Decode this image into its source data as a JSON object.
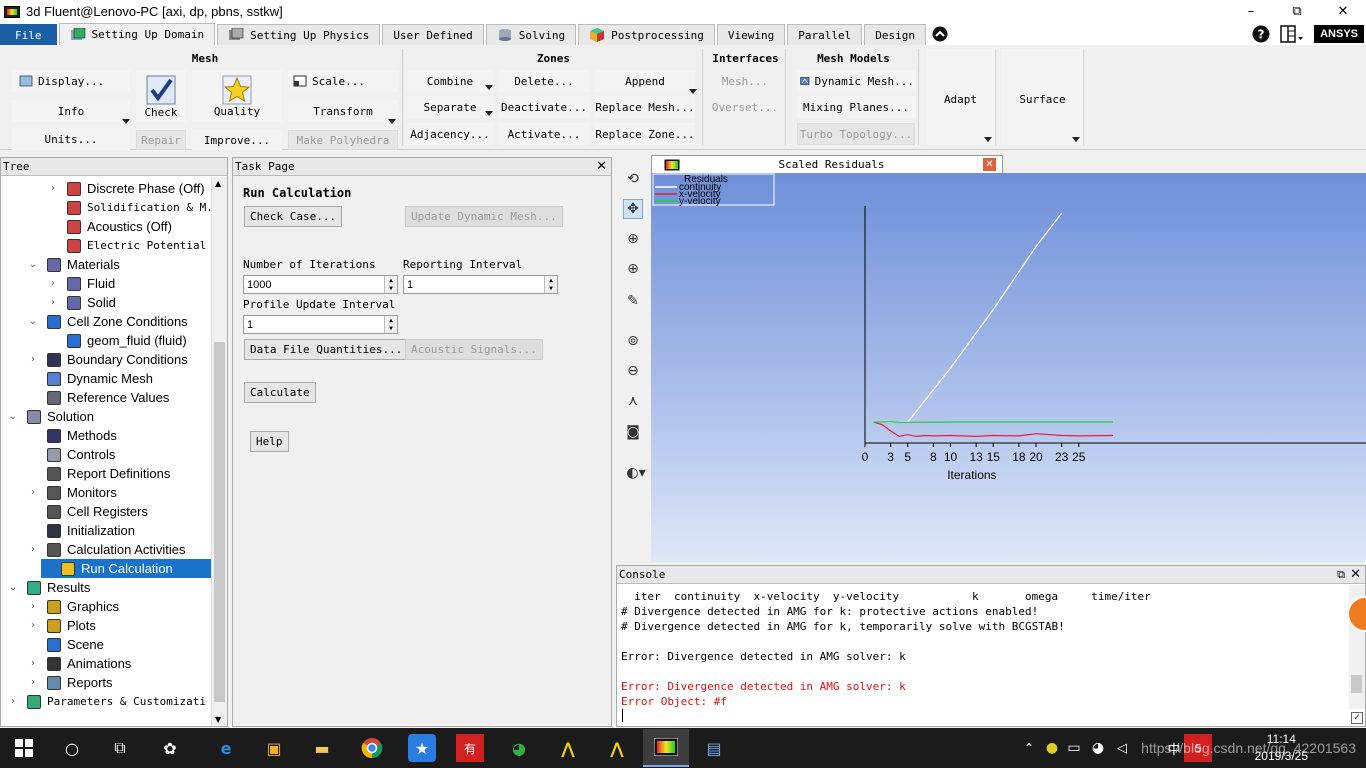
{
  "window": {
    "title": "3d Fluent@Lenovo-PC  [axi, dp, pbns, sstkw]",
    "controls": [
      "–",
      "⧉",
      "✕"
    ]
  },
  "tabs": [
    "File",
    "Setting Up Domain",
    "Setting Up Physics",
    "User Defined",
    "Solving",
    "Postprocessing",
    "Viewing",
    "Parallel",
    "Design"
  ],
  "tab_right": {
    "help": "?",
    "brand": "ANSYS"
  },
  "ribbon": {
    "mesh": {
      "title": "Mesh",
      "display": "Display...",
      "info": "Info",
      "units": "Units...",
      "check": "Check",
      "repair": "Repair",
      "quality": "Quality",
      "improve": "Improve...",
      "scale": "Scale...",
      "transform": "Transform",
      "make_polyhedra": "Make Polyhedra"
    },
    "zones": {
      "title": "Zones",
      "combine": "Combine",
      "separate": "Separate",
      "adjacency": "Adjacency...",
      "delete": "Delete...",
      "deactivate": "Deactivate...",
      "activate": "Activate...",
      "append": "Append",
      "replace_mesh": "Replace Mesh...",
      "replace_zone": "Replace Zone..."
    },
    "interfaces": {
      "title": "Interfaces",
      "mesh": "Mesh...",
      "overset": "Overset..."
    },
    "mesh_models": {
      "title": "Mesh Models",
      "dynamic_mesh": "Dynamic Mesh...",
      "mixing_planes": "Mixing Planes...",
      "turbo_topology": "Turbo Topology..."
    },
    "adapt": "Adapt",
    "surface": "Surface"
  },
  "tree": {
    "header": "Tree",
    "items": [
      {
        "label": "Discrete Phase (Off)"
      },
      {
        "label": "Solidification & M..."
      },
      {
        "label": "Acoustics (Off)"
      },
      {
        "label": "Electric Potential ("
      },
      {
        "label": "Materials"
      },
      {
        "label": "Fluid"
      },
      {
        "label": "Solid"
      },
      {
        "label": "Cell Zone Conditions"
      },
      {
        "label": "geom_fluid (fluid)"
      },
      {
        "label": "Boundary Conditions"
      },
      {
        "label": "Dynamic Mesh"
      },
      {
        "label": "Reference Values"
      },
      {
        "label": "Solution"
      },
      {
        "label": "Methods"
      },
      {
        "label": "Controls"
      },
      {
        "label": "Report Definitions"
      },
      {
        "label": "Monitors"
      },
      {
        "label": "Cell Registers"
      },
      {
        "label": "Initialization"
      },
      {
        "label": "Calculation Activities"
      },
      {
        "label": "Run Calculation"
      },
      {
        "label": "Results"
      },
      {
        "label": "Graphics"
      },
      {
        "label": "Plots"
      },
      {
        "label": "Scene"
      },
      {
        "label": "Animations"
      },
      {
        "label": "Reports"
      },
      {
        "label": "Parameters & Customizati"
      }
    ]
  },
  "task": {
    "header": "Task Page",
    "heading": "Run Calculation",
    "check_case": "Check Case...",
    "update_dynamic_mesh": "Update Dynamic Mesh...",
    "num_iter_label": "Number of Iterations",
    "num_iter_value": "1000",
    "report_interval_label": "Reporting Interval",
    "report_interval_value": "1",
    "profile_update_label": "Profile Update Interval",
    "profile_update_value": "1",
    "data_file_quantities": "Data File Quantities...",
    "acoustic_signals": "Acoustic Signals...",
    "calculate": "Calculate",
    "help": "Help"
  },
  "graphics": {
    "tab_title": "Scaled Residuals"
  },
  "chart_data": {
    "type": "line",
    "title": "",
    "legend_title": "Residuals",
    "xlabel": "Iterations",
    "ylabel": "",
    "x_ticks": [
      "0",
      "3",
      "5",
      "8",
      "10",
      "13",
      "15",
      "18",
      "20",
      "23",
      "25"
    ],
    "xlim": [
      0,
      29
    ],
    "legend_position": "top-left",
    "series": [
      {
        "name": "continuity",
        "color": "#ffffff",
        "x": [
          1,
          2,
          3,
          4,
          5,
          10,
          15,
          20,
          23
        ],
        "y": [
          1.0,
          1.0,
          1.0,
          1.0,
          1.0,
          7.0,
          13.5,
          20.5,
          24.2
        ]
      },
      {
        "name": "x-velocity",
        "color": "#e0203a",
        "x": [
          1,
          2,
          3,
          4,
          5,
          6,
          7,
          8,
          10,
          13,
          15,
          18,
          20,
          23,
          25,
          29
        ],
        "y": [
          1.0,
          0.7,
          0.0,
          -0.6,
          -0.4,
          -0.6,
          -0.5,
          -0.55,
          -0.5,
          -0.6,
          -0.5,
          -0.55,
          -0.3,
          -0.5,
          -0.55,
          -0.5
        ]
      },
      {
        "name": "y-velocity",
        "color": "#20d040",
        "x": [
          1,
          2,
          3,
          4,
          5,
          10,
          15,
          20,
          25,
          29
        ],
        "y": [
          1.0,
          1.0,
          1.05,
          0.95,
          0.95,
          1.0,
          1.0,
          1.0,
          1.0,
          1.0
        ]
      }
    ]
  },
  "console": {
    "header": "Console",
    "lines": [
      {
        "text": "  iter  continuity  x-velocity  y-velocity           k       omega     time/iter",
        "color": "black"
      },
      {
        "text": "# Divergence detected in AMG for k: protective actions enabled!",
        "color": "black"
      },
      {
        "text": "# Divergence detected in AMG for k, temporarily solve with BCGSTAB!",
        "color": "black"
      },
      {
        "text": "",
        "color": "black"
      },
      {
        "text": "Error: Divergence detected in AMG solver: k",
        "color": "black"
      },
      {
        "text": "",
        "color": "black"
      },
      {
        "text": "Error: Divergence detected in AMG solver: k",
        "color": "red"
      },
      {
        "text": "Error Object: #f",
        "color": "red"
      }
    ]
  },
  "taskbar": {
    "time": "11:14",
    "date": "2019/3/25",
    "ime": "中",
    "watermark": "https://blog.csdn.net/qq_42201563"
  }
}
